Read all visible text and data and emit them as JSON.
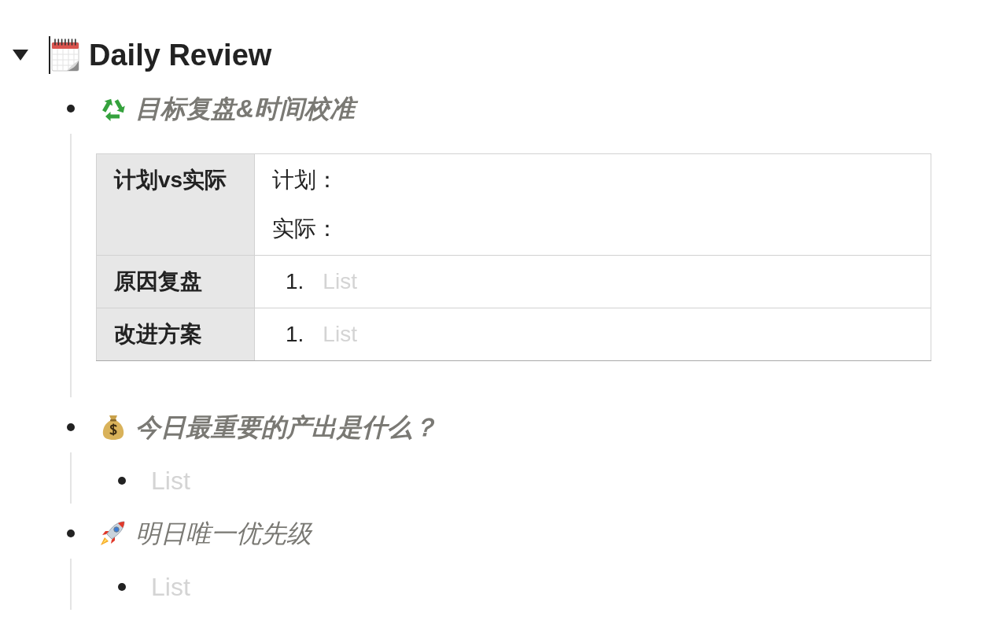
{
  "toggle": {
    "expanded": true,
    "focused": true,
    "title": "Daily Review",
    "children": [
      {
        "heading": "目标复盘&时间校准",
        "bold": true,
        "kind": "table",
        "table": {
          "rows": [
            {
              "header": "计划vs实际",
              "cell": {
                "kind": "lines",
                "lines": [
                  "计划：",
                  "实际："
                ]
              }
            },
            {
              "header": "原因复盘",
              "cell": {
                "kind": "numbered",
                "items": [
                  {
                    "number": "1.",
                    "placeholder": "List"
                  }
                ]
              }
            },
            {
              "header": "改进方案",
              "cell": {
                "kind": "numbered",
                "items": [
                  {
                    "number": "1.",
                    "placeholder": "List"
                  }
                ]
              }
            }
          ]
        }
      },
      {
        "heading": "今日最重要的产出是什么？",
        "bold": true,
        "kind": "bullets",
        "items": [
          {
            "placeholder": "List"
          }
        ]
      },
      {
        "heading": "明日唯一优先级",
        "bold": false,
        "kind": "bullets",
        "items": [
          {
            "placeholder": "List"
          }
        ]
      }
    ]
  }
}
